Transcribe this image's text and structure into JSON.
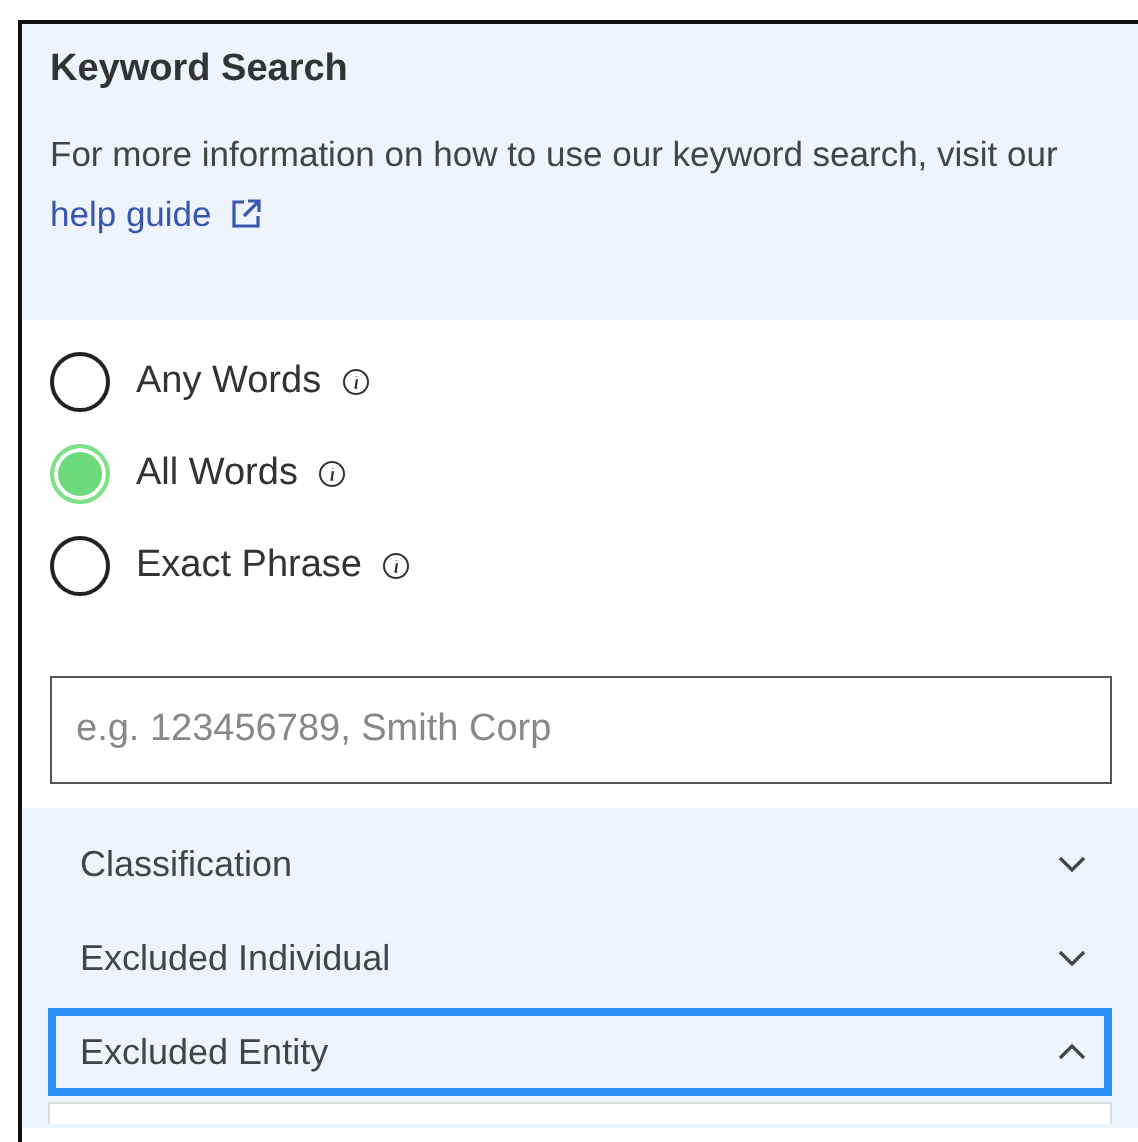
{
  "header": {
    "title": "Keyword Search",
    "description": "For more information on how to use our keyword search, visit our",
    "link": "help guide"
  },
  "match_options": [
    {
      "label": "Any Words",
      "selected": false
    },
    {
      "label": "All Words",
      "selected": true
    },
    {
      "label": "Exact Phrase",
      "selected": false
    }
  ],
  "search": {
    "placeholder": "e.g. 123456789, Smith Corp"
  },
  "filters": [
    {
      "label": "Classification",
      "expanded": false,
      "focused": false
    },
    {
      "label": "Excluded Individual",
      "expanded": false,
      "focused": false
    },
    {
      "label": "Excluded Entity",
      "expanded": true,
      "focused": true
    }
  ]
}
